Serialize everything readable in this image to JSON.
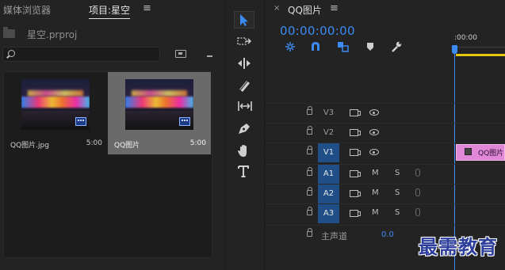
{
  "project_panel": {
    "tab_media_browser": "媒体浏览器",
    "tab_project": "项目:星空",
    "menu_icon": "≡",
    "file_name": "星空.prproj",
    "search": {
      "value": "",
      "placeholder": ""
    },
    "clips": [
      {
        "name": "QQ图片.jpg",
        "duration": "5:00"
      },
      {
        "name": "QQ图片",
        "duration": "5:00"
      }
    ]
  },
  "tools": [
    "selection-tool",
    "track-select-tool",
    "ripple-edit-tool",
    "razor-tool",
    "slip-tool",
    "pen-tool",
    "hand-tool",
    "type-tool"
  ],
  "timeline": {
    "close_icon": "×",
    "title": "QQ图片",
    "menu_icon": "≡",
    "timecode": "00:00:00:00",
    "ruler_label": ":00:00",
    "accent_color": "#3b8bf2",
    "tracks": [
      {
        "name": "V3",
        "type": "video",
        "active": false
      },
      {
        "name": "V2",
        "type": "video",
        "active": false
      },
      {
        "name": "V1",
        "type": "video",
        "active": true
      },
      {
        "name": "A1",
        "type": "audio",
        "active": true
      },
      {
        "name": "A2",
        "type": "audio",
        "active": true
      },
      {
        "name": "A3",
        "type": "audio",
        "active": true
      }
    ],
    "mute_label": "M",
    "solo_label": "S",
    "master": {
      "label": "主声道",
      "value": "0.0"
    },
    "clip": {
      "label": "QQ图片",
      "color": "#e087d8"
    }
  },
  "watermark": "最需教育"
}
